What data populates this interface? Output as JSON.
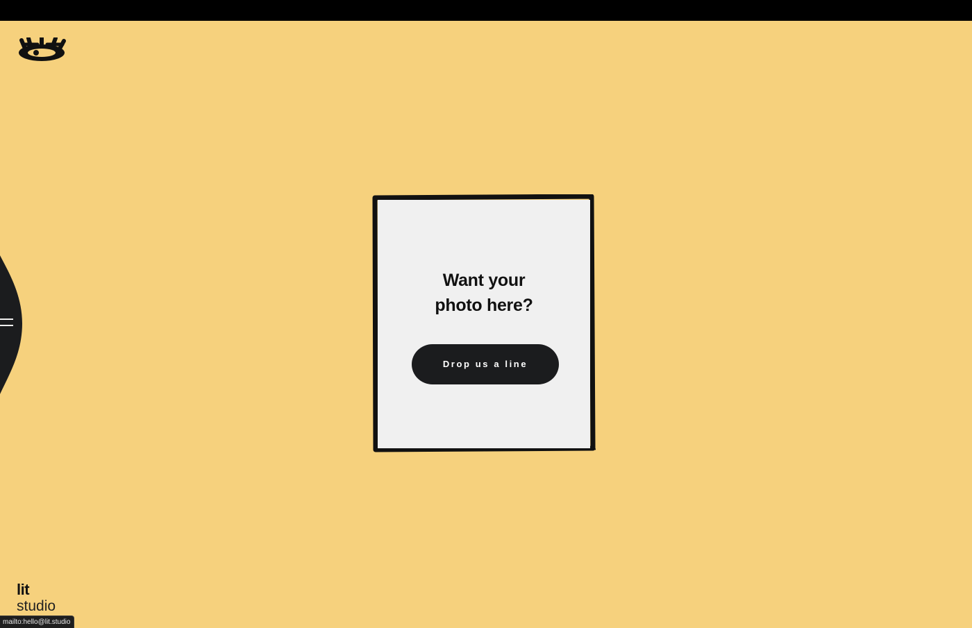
{
  "colors": {
    "background": "#f6d17d",
    "card": "#f0f0f0",
    "ink": "#111111",
    "button": "#1b1c1e",
    "button_text": "#ffffff"
  },
  "header": {
    "logo_icon": "eye-with-lashes-icon"
  },
  "side_menu": {
    "icon": "hamburger-menu-icon"
  },
  "card": {
    "headline_line1": "Want your",
    "headline_line2": "photo here?",
    "cta_label": "Drop us a line"
  },
  "brand": {
    "line1": "lit",
    "line2": "studio"
  },
  "status_bar": {
    "url": "mailto:hello@lit.studio"
  }
}
